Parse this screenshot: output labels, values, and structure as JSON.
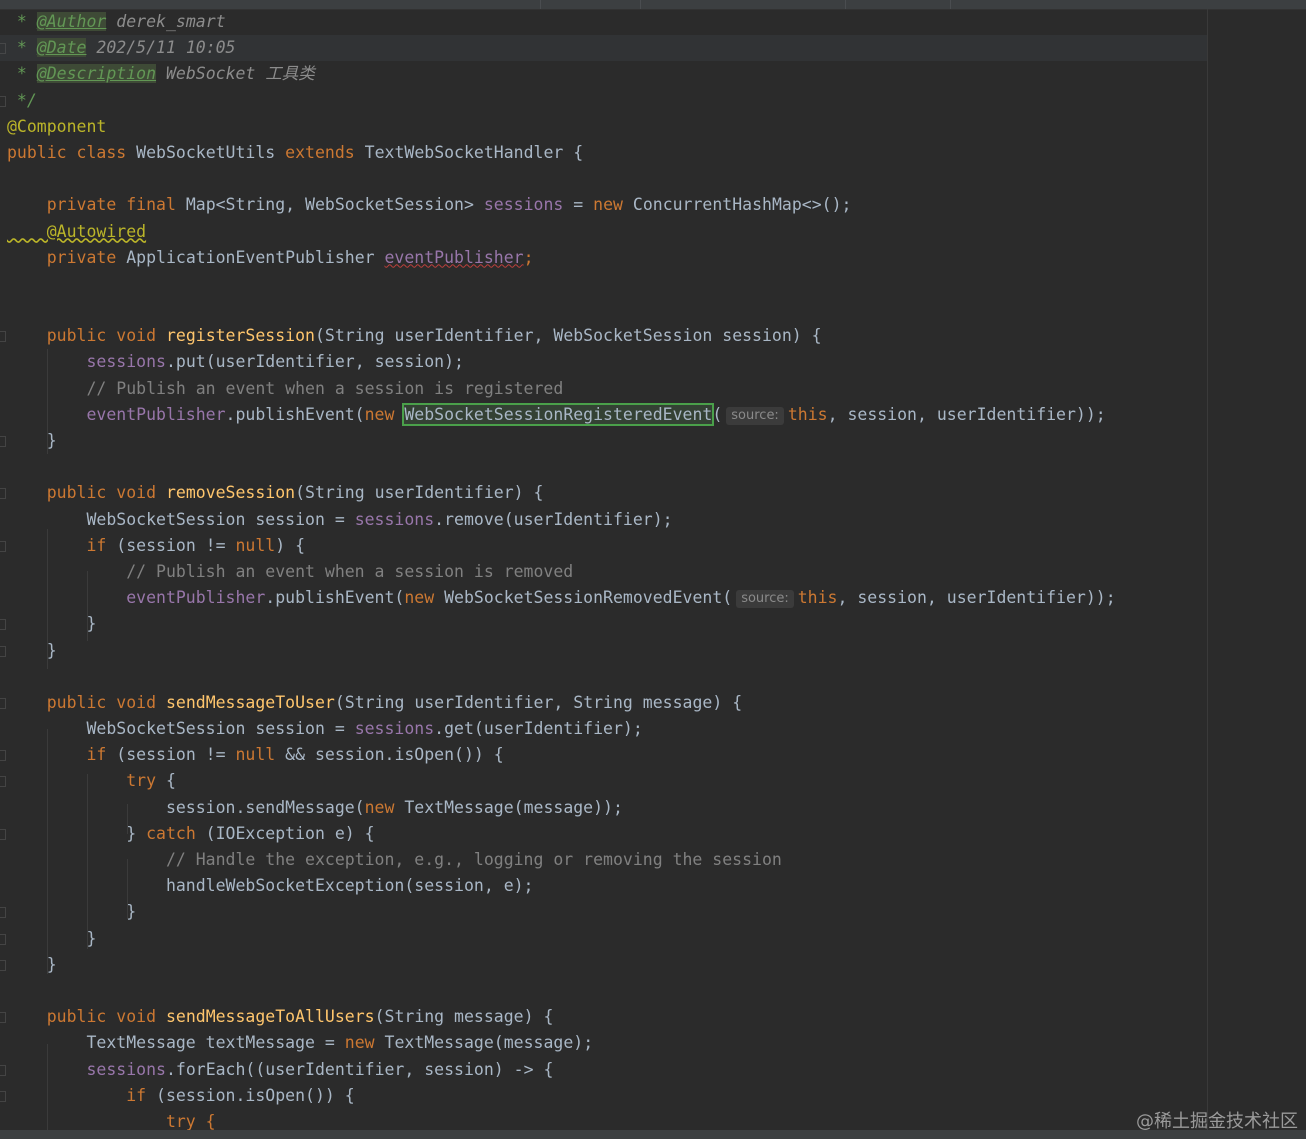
{
  "doc_comment": {
    "author_line": {
      "prefix": " * ",
      "tag": "@Author",
      "value": " derek_smart"
    },
    "date_line": {
      "prefix": " * ",
      "tag": "@Date",
      "value": " 202/5/11 10:05"
    },
    "description_line": {
      "prefix": " * ",
      "tag": "@Description",
      "value": " WebSocket 工具类"
    },
    "close": " */"
  },
  "annotation_component": "@Component",
  "class_decl": {
    "kw1": "public",
    "kw2": "class",
    "name": " WebSocketUtils ",
    "kw3": "extends",
    "rest": " TextWebSocketHandler {"
  },
  "field1": {
    "kw1": "    private",
    "kw2": " final",
    "type": " Map<String, WebSocketSession> ",
    "name": "sessions",
    "eq": " = ",
    "kw3": "new",
    "rest": " ConcurrentHashMap<>();"
  },
  "autowired": "    @Autowired",
  "field2": {
    "kw": "    private",
    "type": " ApplicationEventPublisher ",
    "name": "eventPublisher",
    "semi": ";"
  },
  "register": {
    "sig": {
      "kw": "    public void ",
      "fn": "registerSession",
      "rest": "(String userIdentifier, WebSocketSession session) {"
    },
    "put": {
      "fld": "        sessions",
      "rest": ".put(userIdentifier, session);"
    },
    "comment": "        // Publish an event when a session is registered",
    "publish": {
      "fld": "        eventPublisher",
      "mid": ".publishEvent(",
      "kw": "new",
      "sp": " ",
      "cls": "WebSocketSessionRegisteredEvent",
      "paren": "(",
      "hint": "source:",
      "kw2": "this",
      "rest": ", session, userIdentifier));"
    },
    "close": "    }"
  },
  "remove": {
    "sig": {
      "kw": "    public void ",
      "fn": "removeSession",
      "rest": "(String userIdentifier) {"
    },
    "get": {
      "pre": "        WebSocketSession session = ",
      "fld": "sessions",
      "rest": ".remove(userIdentifier);"
    },
    "if": {
      "kw": "        if",
      "rest": " (session != ",
      "kw2": "null",
      "rest2": ") {"
    },
    "comment": "            // Publish an event when a session is removed",
    "publish": {
      "fld": "            eventPublisher",
      "mid": ".publishEvent(",
      "kw": "new",
      "cls": " WebSocketSessionRemovedEvent(",
      "hint": "source:",
      "kw2": "this",
      "rest": ", session, userIdentifier));"
    },
    "close_if": "        }",
    "close": "    }"
  },
  "send_user": {
    "sig": {
      "kw": "    public void ",
      "fn": "sendMessageToUser",
      "rest": "(String userIdentifier, String message) {"
    },
    "get": {
      "pre": "        WebSocketSession session = ",
      "fld": "sessions",
      "rest": ".get(userIdentifier);"
    },
    "if": {
      "kw": "        if",
      "rest": " (session != ",
      "kw2": "null",
      "rest2": " && session.isOpen()) {"
    },
    "try": {
      "kw": "            try",
      "rest": " {"
    },
    "send": {
      "pre": "                session.sendMessage(",
      "kw": "new",
      "rest": " TextMessage(message));"
    },
    "catch": {
      "pre": "            } ",
      "kw": "catch",
      "rest": " (IOException e) {"
    },
    "comment": "                // Handle the exception, e.g., logging or removing the session",
    "handle": "                handleWebSocketException(session, e);",
    "close_catch": "            }",
    "close_if": "        }",
    "close": "    }"
  },
  "send_all": {
    "sig": {
      "kw": "    public void ",
      "fn": "sendMessageToAllUsers",
      "rest": "(String message) {"
    },
    "msg": {
      "pre": "        TextMessage textMessage = ",
      "kw": "new",
      "rest": " TextMessage(message);"
    },
    "foreach": {
      "fld": "        sessions",
      "rest": ".forEach((userIdentifier, session) -> {"
    },
    "if": {
      "kw": "            if",
      "rest": " (session.isOpen()) {"
    },
    "try_partial": "                try {"
  },
  "watermark": "@稀土掘金技术社区"
}
